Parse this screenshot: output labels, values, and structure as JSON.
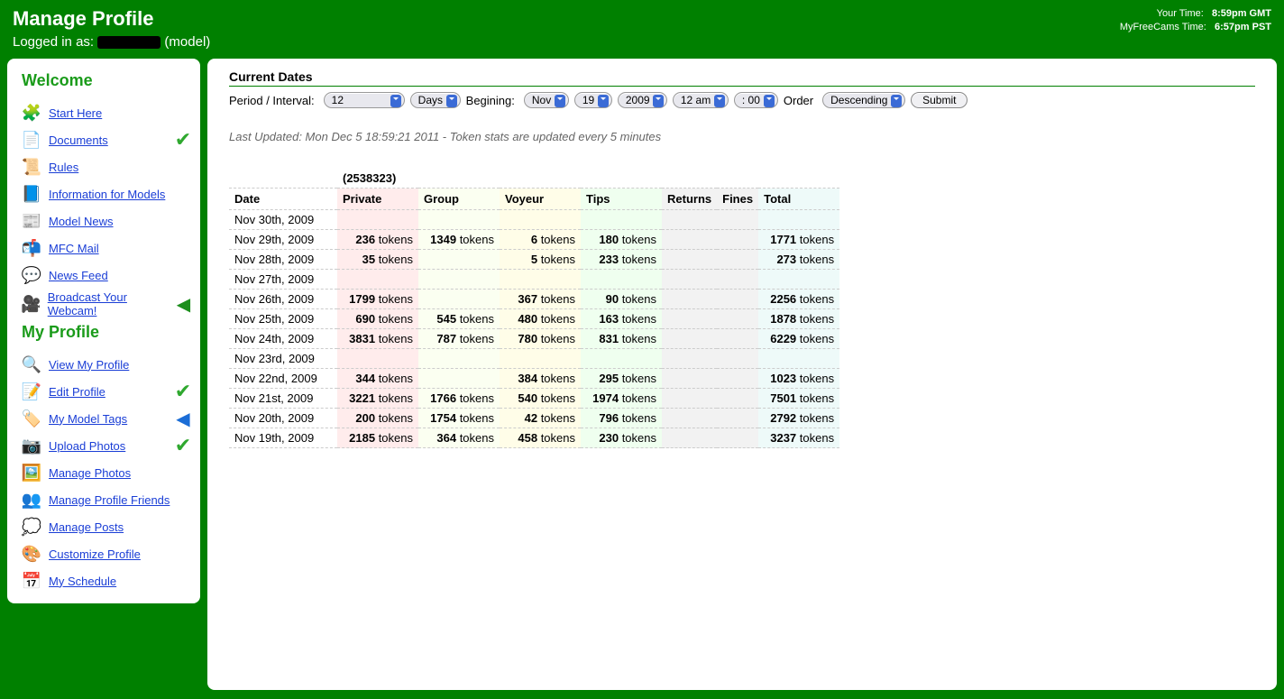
{
  "header": {
    "title": "Manage Profile",
    "logged_prefix": "Logged in as:",
    "logged_suffix": "(model)",
    "your_time_label": "Your Time:",
    "your_time_value": "8:59pm GMT",
    "mfc_time_label": "MyFreeCams Time:",
    "mfc_time_value": "6:57pm PST"
  },
  "sidebar": {
    "welcome_title": "Welcome",
    "profile_title": "My Profile",
    "items1": [
      {
        "label": "Start Here",
        "icon": "🧩",
        "badge": ""
      },
      {
        "label": "Documents",
        "icon": "📄",
        "badge": "check"
      },
      {
        "label": "Rules",
        "icon": "📜",
        "badge": ""
      },
      {
        "label": "Information for Models",
        "icon": "📘",
        "badge": ""
      },
      {
        "label": "Model News",
        "icon": "📰",
        "badge": ""
      },
      {
        "label": "MFC Mail",
        "icon": "📬",
        "badge": ""
      },
      {
        "label": "News Feed",
        "icon": "💬",
        "badge": ""
      },
      {
        "label": "Broadcast Your Webcam!",
        "icon": "🎥",
        "badge": "arrow-green"
      }
    ],
    "items2": [
      {
        "label": "View My Profile",
        "icon": "🔍",
        "badge": ""
      },
      {
        "label": "Edit Profile",
        "icon": "📝",
        "badge": "check"
      },
      {
        "label": "My Model Tags",
        "icon": "🏷️",
        "badge": "arrow-blue"
      },
      {
        "label": "Upload Photos",
        "icon": "📷",
        "badge": "check"
      },
      {
        "label": "Manage Photos",
        "icon": "🖼️",
        "badge": ""
      },
      {
        "label": "Manage Profile Friends",
        "icon": "👥",
        "badge": ""
      },
      {
        "label": "Manage Posts",
        "icon": "💭",
        "badge": ""
      },
      {
        "label": "Customize Profile",
        "icon": "🎨",
        "badge": ""
      },
      {
        "label": "My Schedule",
        "icon": "📅",
        "badge": ""
      }
    ]
  },
  "main": {
    "section_title": "Current Dates",
    "period_label": "Period / Interval:",
    "period_value": "12",
    "unit_value": "Days",
    "begin_label": "Begining:",
    "month_value": "Nov",
    "day_value": "19",
    "year_value": "2009",
    "hour_value": "12 am",
    "minute_value": ": 00",
    "order_label": "Order",
    "order_value": "Descending",
    "submit_label": "Submit",
    "updated": "Last Updated: Mon Dec 5 18:59:21 2011 - Token stats are updated every 5 minutes",
    "cols": {
      "date": "Date",
      "id": "(2538323)",
      "private": "Private",
      "group": "Group",
      "voyeur": "Voyeur",
      "tips": "Tips",
      "returns": "Returns",
      "fines": "Fines",
      "total": "Total"
    },
    "unit": "tokens",
    "rows": [
      {
        "date": "Nov 30th, 2009"
      },
      {
        "date": "Nov 29th, 2009",
        "private": 236,
        "group": 1349,
        "voyeur": 6,
        "tips": 180,
        "total": 1771
      },
      {
        "date": "Nov 28th, 2009",
        "private": 35,
        "voyeur": 5,
        "tips": 233,
        "total": 273
      },
      {
        "date": "Nov 27th, 2009"
      },
      {
        "date": "Nov 26th, 2009",
        "private": 1799,
        "voyeur": 367,
        "tips": 90,
        "total": 2256
      },
      {
        "date": "Nov 25th, 2009",
        "private": 690,
        "group": 545,
        "voyeur": 480,
        "tips": 163,
        "total": 1878
      },
      {
        "date": "Nov 24th, 2009",
        "private": 3831,
        "group": 787,
        "voyeur": 780,
        "tips": 831,
        "total": 6229
      },
      {
        "date": "Nov 23rd, 2009"
      },
      {
        "date": "Nov 22nd, 2009",
        "private": 344,
        "voyeur": 384,
        "tips": 295,
        "total": 1023
      },
      {
        "date": "Nov 21st, 2009",
        "private": 3221,
        "group": 1766,
        "voyeur": 540,
        "tips": 1974,
        "total": 7501
      },
      {
        "date": "Nov 20th, 2009",
        "private": 200,
        "group": 1754,
        "voyeur": 42,
        "tips": 796,
        "total": 2792
      },
      {
        "date": "Nov 19th, 2009",
        "private": 2185,
        "group": 364,
        "voyeur": 458,
        "tips": 230,
        "total": 3237
      }
    ]
  },
  "chart_data": {
    "type": "table",
    "title": "(2538323)",
    "columns": [
      "Date",
      "Private",
      "Group",
      "Voyeur",
      "Tips",
      "Returns",
      "Fines",
      "Total"
    ],
    "unit": "tokens",
    "rows": [
      [
        "Nov 30th, 2009",
        null,
        null,
        null,
        null,
        null,
        null,
        null
      ],
      [
        "Nov 29th, 2009",
        236,
        1349,
        6,
        180,
        null,
        null,
        1771
      ],
      [
        "Nov 28th, 2009",
        35,
        null,
        5,
        233,
        null,
        null,
        273
      ],
      [
        "Nov 27th, 2009",
        null,
        null,
        null,
        null,
        null,
        null,
        null
      ],
      [
        "Nov 26th, 2009",
        1799,
        null,
        367,
        90,
        null,
        null,
        2256
      ],
      [
        "Nov 25th, 2009",
        690,
        545,
        480,
        163,
        null,
        null,
        1878
      ],
      [
        "Nov 24th, 2009",
        3831,
        787,
        780,
        831,
        null,
        null,
        6229
      ],
      [
        "Nov 23rd, 2009",
        null,
        null,
        null,
        null,
        null,
        null,
        null
      ],
      [
        "Nov 22nd, 2009",
        344,
        null,
        384,
        295,
        null,
        null,
        1023
      ],
      [
        "Nov 21st, 2009",
        3221,
        1766,
        540,
        1974,
        null,
        null,
        7501
      ],
      [
        "Nov 20th, 2009",
        200,
        1754,
        42,
        796,
        null,
        null,
        2792
      ],
      [
        "Nov 19th, 2009",
        2185,
        364,
        458,
        230,
        null,
        null,
        3237
      ]
    ]
  }
}
